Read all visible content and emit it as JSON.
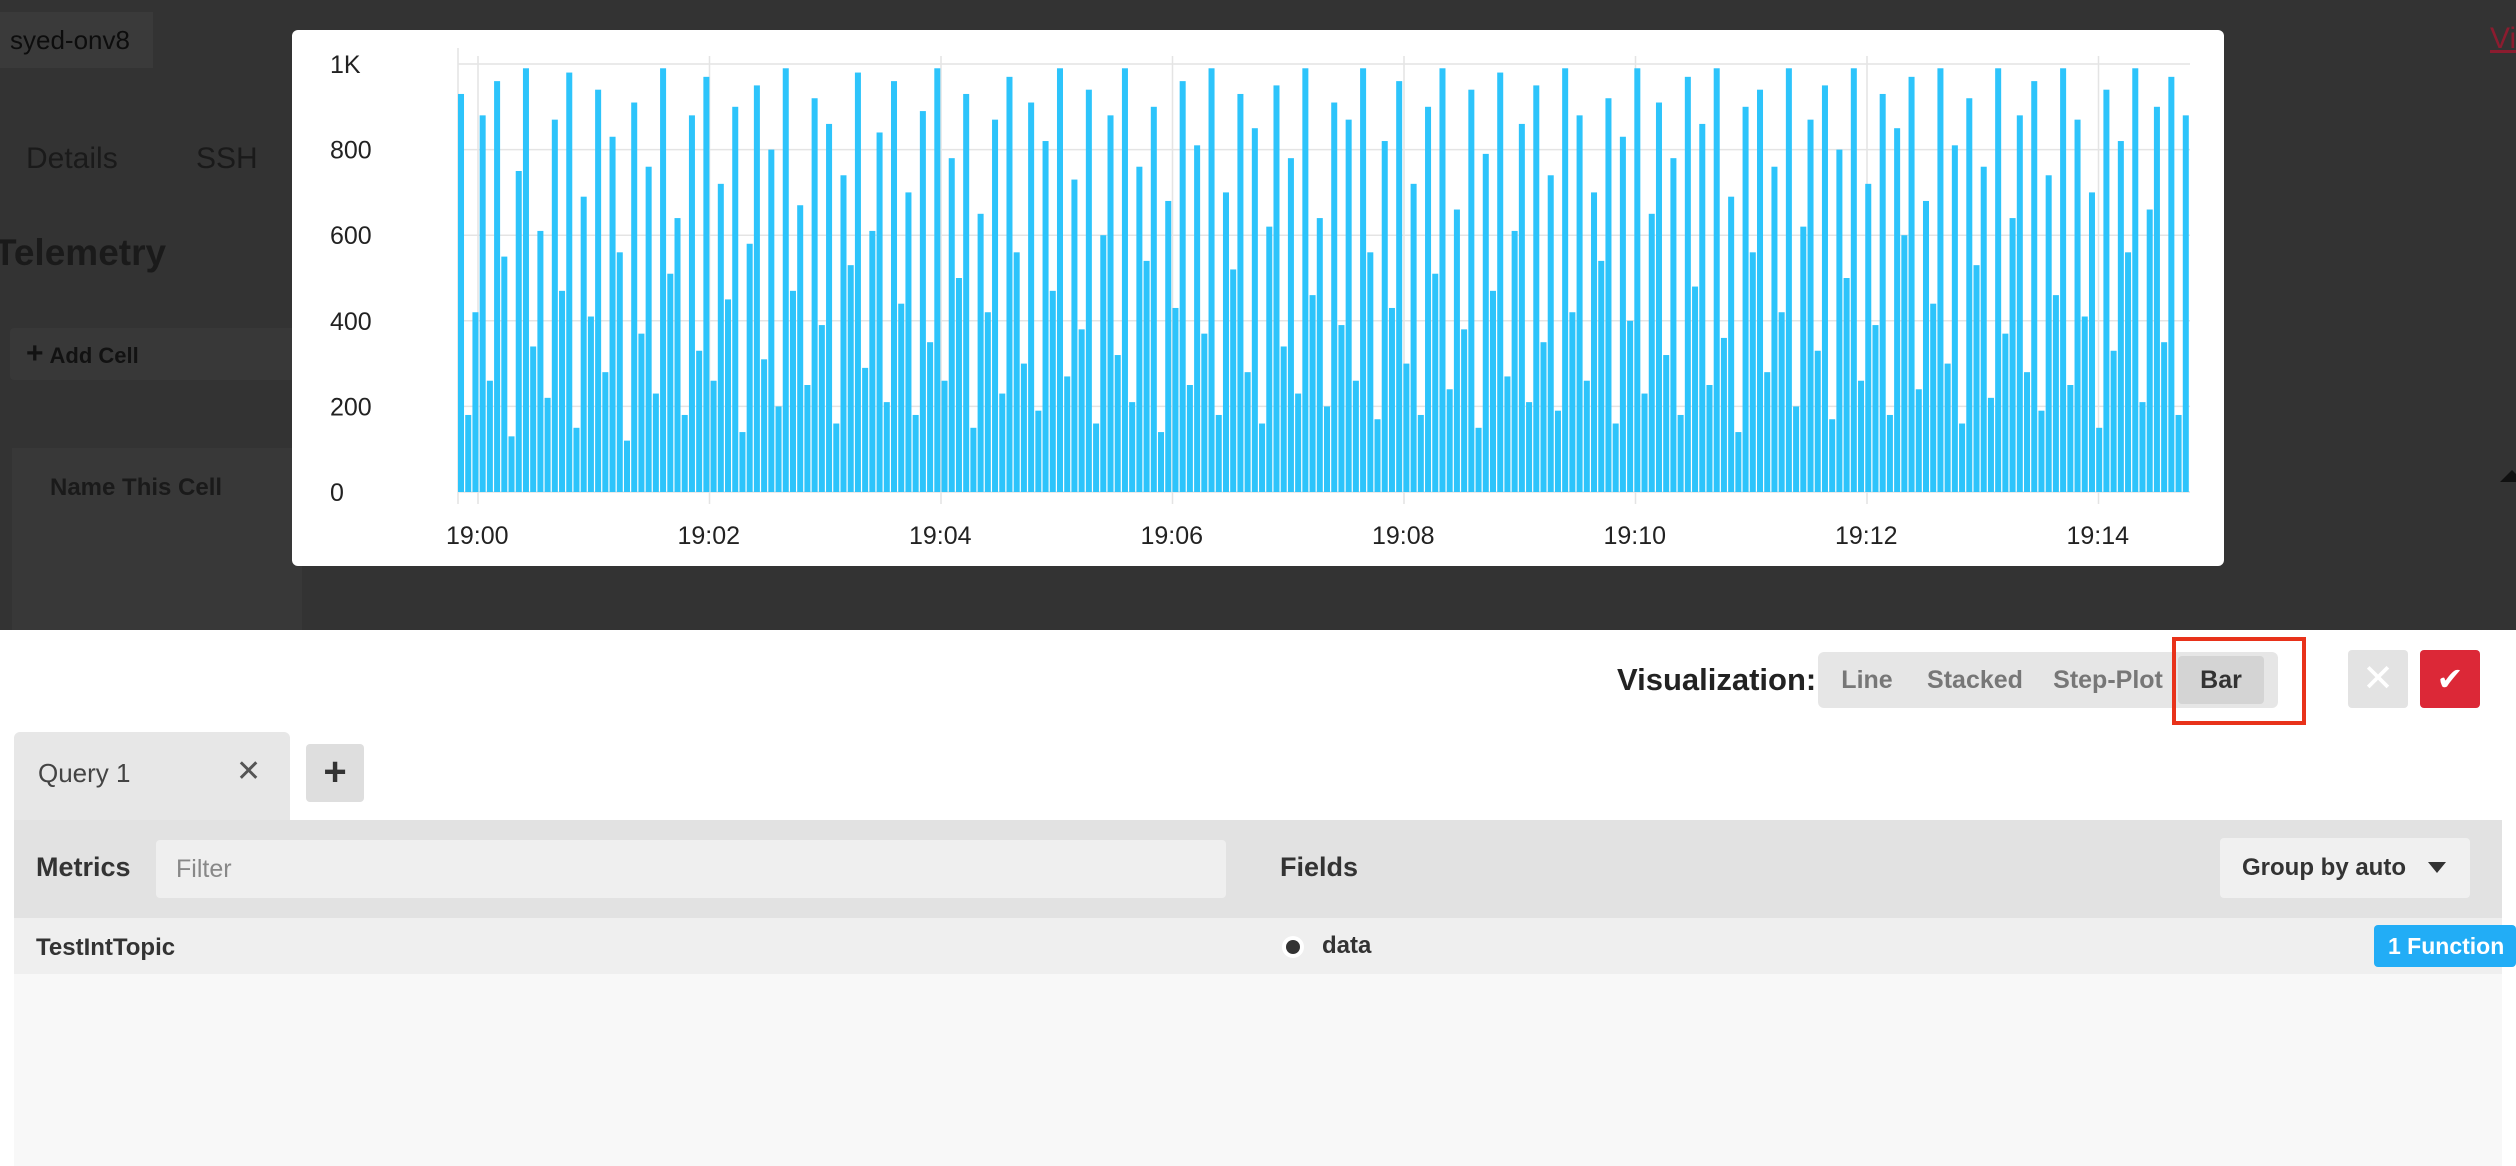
{
  "background": {
    "host_name": "syed-onv8",
    "top_right_link": "Vi",
    "tabs": [
      "Details",
      "SSH"
    ],
    "dashboard_title": "Telemetry",
    "add_cell_label": "Add Cell",
    "cell_name": "Name This Cell"
  },
  "visualization": {
    "label": "Visualization:",
    "options": [
      "Line",
      "Stacked",
      "Step-Plot",
      "Bar"
    ],
    "selected": "Bar"
  },
  "actions": {
    "cancel_icon": "close-icon",
    "confirm_icon": "check-icon"
  },
  "query_tabs": [
    {
      "label": "Query 1"
    }
  ],
  "builder": {
    "metrics_label": "Metrics",
    "filter_placeholder": "Filter",
    "fields_label": "Fields",
    "group_by_label": "Group by auto",
    "metric_item": "TestIntTopic",
    "field_item": "data",
    "function_button": "1 Function"
  },
  "colors": {
    "bar": "#2dc4fb",
    "confirm": "#dc2837",
    "function": "#22adf6",
    "highlight": "#e8321a"
  },
  "chart_data": {
    "type": "bar",
    "x_ticks": [
      "19:00",
      "19:02",
      "19:04",
      "19:06",
      "19:08",
      "19:10",
      "19:12",
      "19:14"
    ],
    "y_ticks": [
      "0",
      "200",
      "400",
      "600",
      "800",
      "1K"
    ],
    "ylim": [
      0,
      1000
    ],
    "xlim": [
      "18:59:40",
      "19:14:40"
    ],
    "grid": true,
    "series": [
      {
        "color": "#2dc4fb",
        "values": [
          930,
          180,
          420,
          880,
          260,
          960,
          550,
          130,
          750,
          990,
          340,
          610,
          220,
          870,
          470,
          980,
          150,
          690,
          410,
          940,
          280,
          830,
          560,
          120,
          910,
          370,
          760,
          230,
          990,
          510,
          640,
          180,
          880,
          330,
          970,
          260,
          720,
          450,
          900,
          140,
          580,
          950,
          310,
          800,
          200,
          990,
          470,
          670,
          250,
          920,
          390,
          860,
          160,
          740,
          530,
          980,
          290,
          610,
          840,
          210,
          960,
          440,
          700,
          180,
          890,
          350,
          990,
          260,
          780,
          500,
          930,
          150,
          650,
          420,
          870,
          230,
          970,
          560,
          300,
          910,
          190,
          820,
          470,
          990,
          270,
          730,
          380,
          940,
          160,
          600,
          880,
          320,
          990,
          210,
          760,
          540,
          900,
          140,
          680,
          430,
          960,
          250,
          810,
          370,
          990,
          180,
          700,
          520,
          930,
          280,
          850,
          160,
          620,
          950,
          340,
          780,
          230,
          990,
          460,
          640,
          200,
          910,
          390,
          870,
          260,
          990,
          560,
          170,
          820,
          430,
          960,
          300,
          720,
          180,
          900,
          510,
          990,
          240,
          660,
          380,
          940,
          150,
          790,
          470,
          980,
          270,
          610,
          860,
          210,
          950,
          350,
          740,
          190,
          990,
          420,
          880,
          260,
          700,
          540,
          920,
          160,
          830,
          400,
          990,
          230,
          650,
          910,
          320,
          780,
          180,
          970,
          480,
          860,
          250,
          990,
          360,
          690,
          140,
          900,
          560,
          940,
          280,
          760,
          420,
          990,
          200,
          620,
          870,
          330,
          950,
          170,
          800,
          500,
          990,
          260,
          720,
          390,
          930,
          180,
          850,
          600,
          970,
          240,
          680,
          440,
          990,
          300,
          810,
          160,
          920,
          530,
          760,
          220,
          990,
          370,
          640,
          880,
          280,
          960,
          190,
          740,
          460,
          990,
          250,
          870,
          410,
          700,
          150,
          940,
          330,
          820,
          560,
          990,
          210,
          660,
          900,
          350,
          970,
          180,
          880
        ]
      }
    ]
  }
}
